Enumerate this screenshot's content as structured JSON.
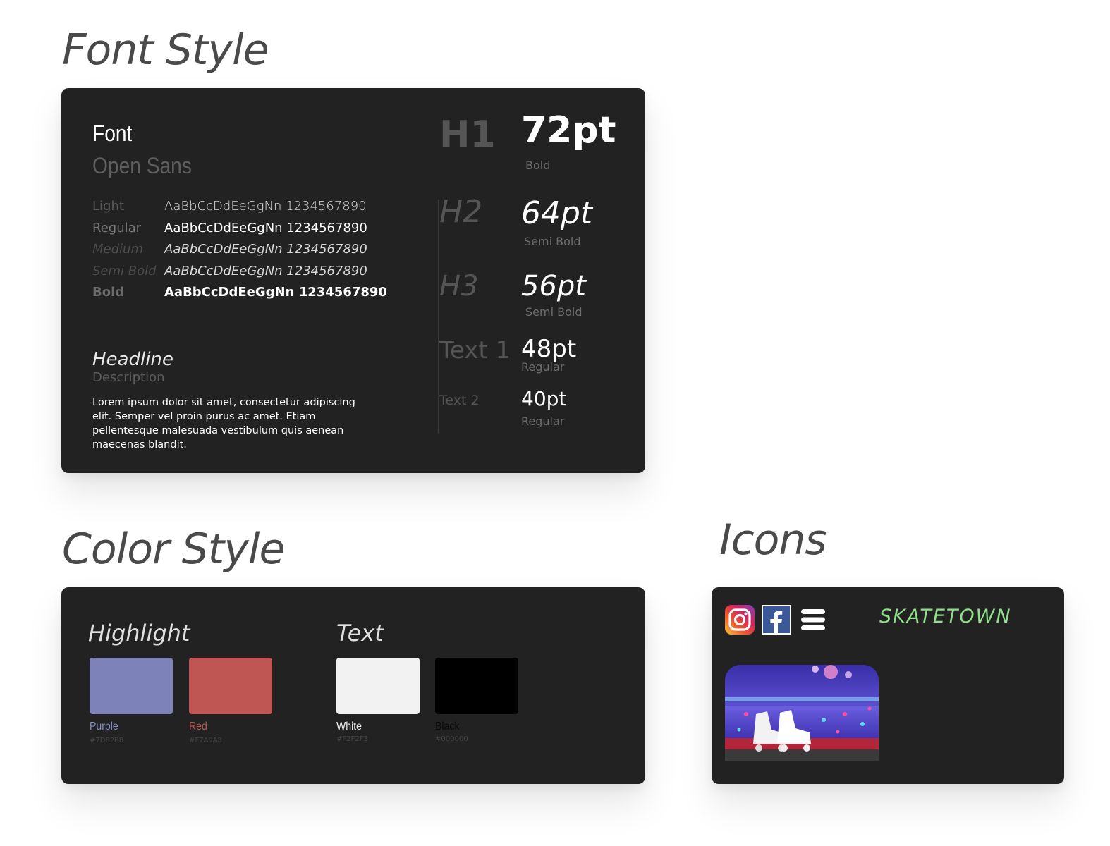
{
  "sections": {
    "font_title": "Font Style",
    "color_title": "Color Style",
    "icons_title": "Icons"
  },
  "font_card": {
    "label": "Font",
    "family": "Open Sans",
    "weights": [
      {
        "name": "Light",
        "sample": "AaBbCcDdEeGgNn 1234567890"
      },
      {
        "name": "Regular",
        "sample": "AaBbCcDdEeGgNn 1234567890"
      },
      {
        "name": "Medium",
        "sample": "AaBbCcDdEeGgNn 1234567890"
      },
      {
        "name": "Semi Bold",
        "sample": "AaBbCcDdEeGgNn 1234567890"
      },
      {
        "name": "Bold",
        "sample": "AaBbCcDdEeGgNn 1234567890"
      }
    ],
    "headline": "Headline",
    "description": "Description",
    "body": "Lorem ipsum dolor sit amet, consectetur adipiscing elit. Semper vel proin purus ac amet. Etiam pellentesque malesuada vestibulum quis aenean maecenas blandit.",
    "scale": [
      {
        "tag": "H1",
        "size": "72pt",
        "weight": "Bold"
      },
      {
        "tag": "H2",
        "size": "64pt",
        "weight": "Semi Bold"
      },
      {
        "tag": "H3",
        "size": "56pt",
        "weight": "Semi Bold"
      },
      {
        "tag": "Text 1",
        "size": "48pt",
        "weight": "Regular"
      },
      {
        "tag": "Text 2",
        "size": "40pt",
        "weight": "Regular"
      }
    ]
  },
  "color_card": {
    "highlight_title": "Highlight",
    "text_title": "Text",
    "swatches": [
      {
        "name": "Purple",
        "hex": "#7D82B8",
        "color": "#7d82b8",
        "label_color": "#8a8fc6"
      },
      {
        "name": "Red",
        "hex": "#F7A9A8",
        "color": "#c05654",
        "label_color": "#c05654"
      },
      {
        "name": "White",
        "hex": "#F2F2F3",
        "color": "#f2f2f3",
        "label_color": "#f2f2f3"
      },
      {
        "name": "Black",
        "hex": "#000000",
        "color": "#000000",
        "label_color": "#0a0a0a"
      }
    ]
  },
  "icons_card": {
    "icons": [
      "instagram-icon",
      "facebook-icon",
      "hamburger-menu-icon"
    ],
    "brand": "SKATETOWN",
    "brand_color": "#8fe08a",
    "photo": "roller-skates-rink-photo"
  }
}
